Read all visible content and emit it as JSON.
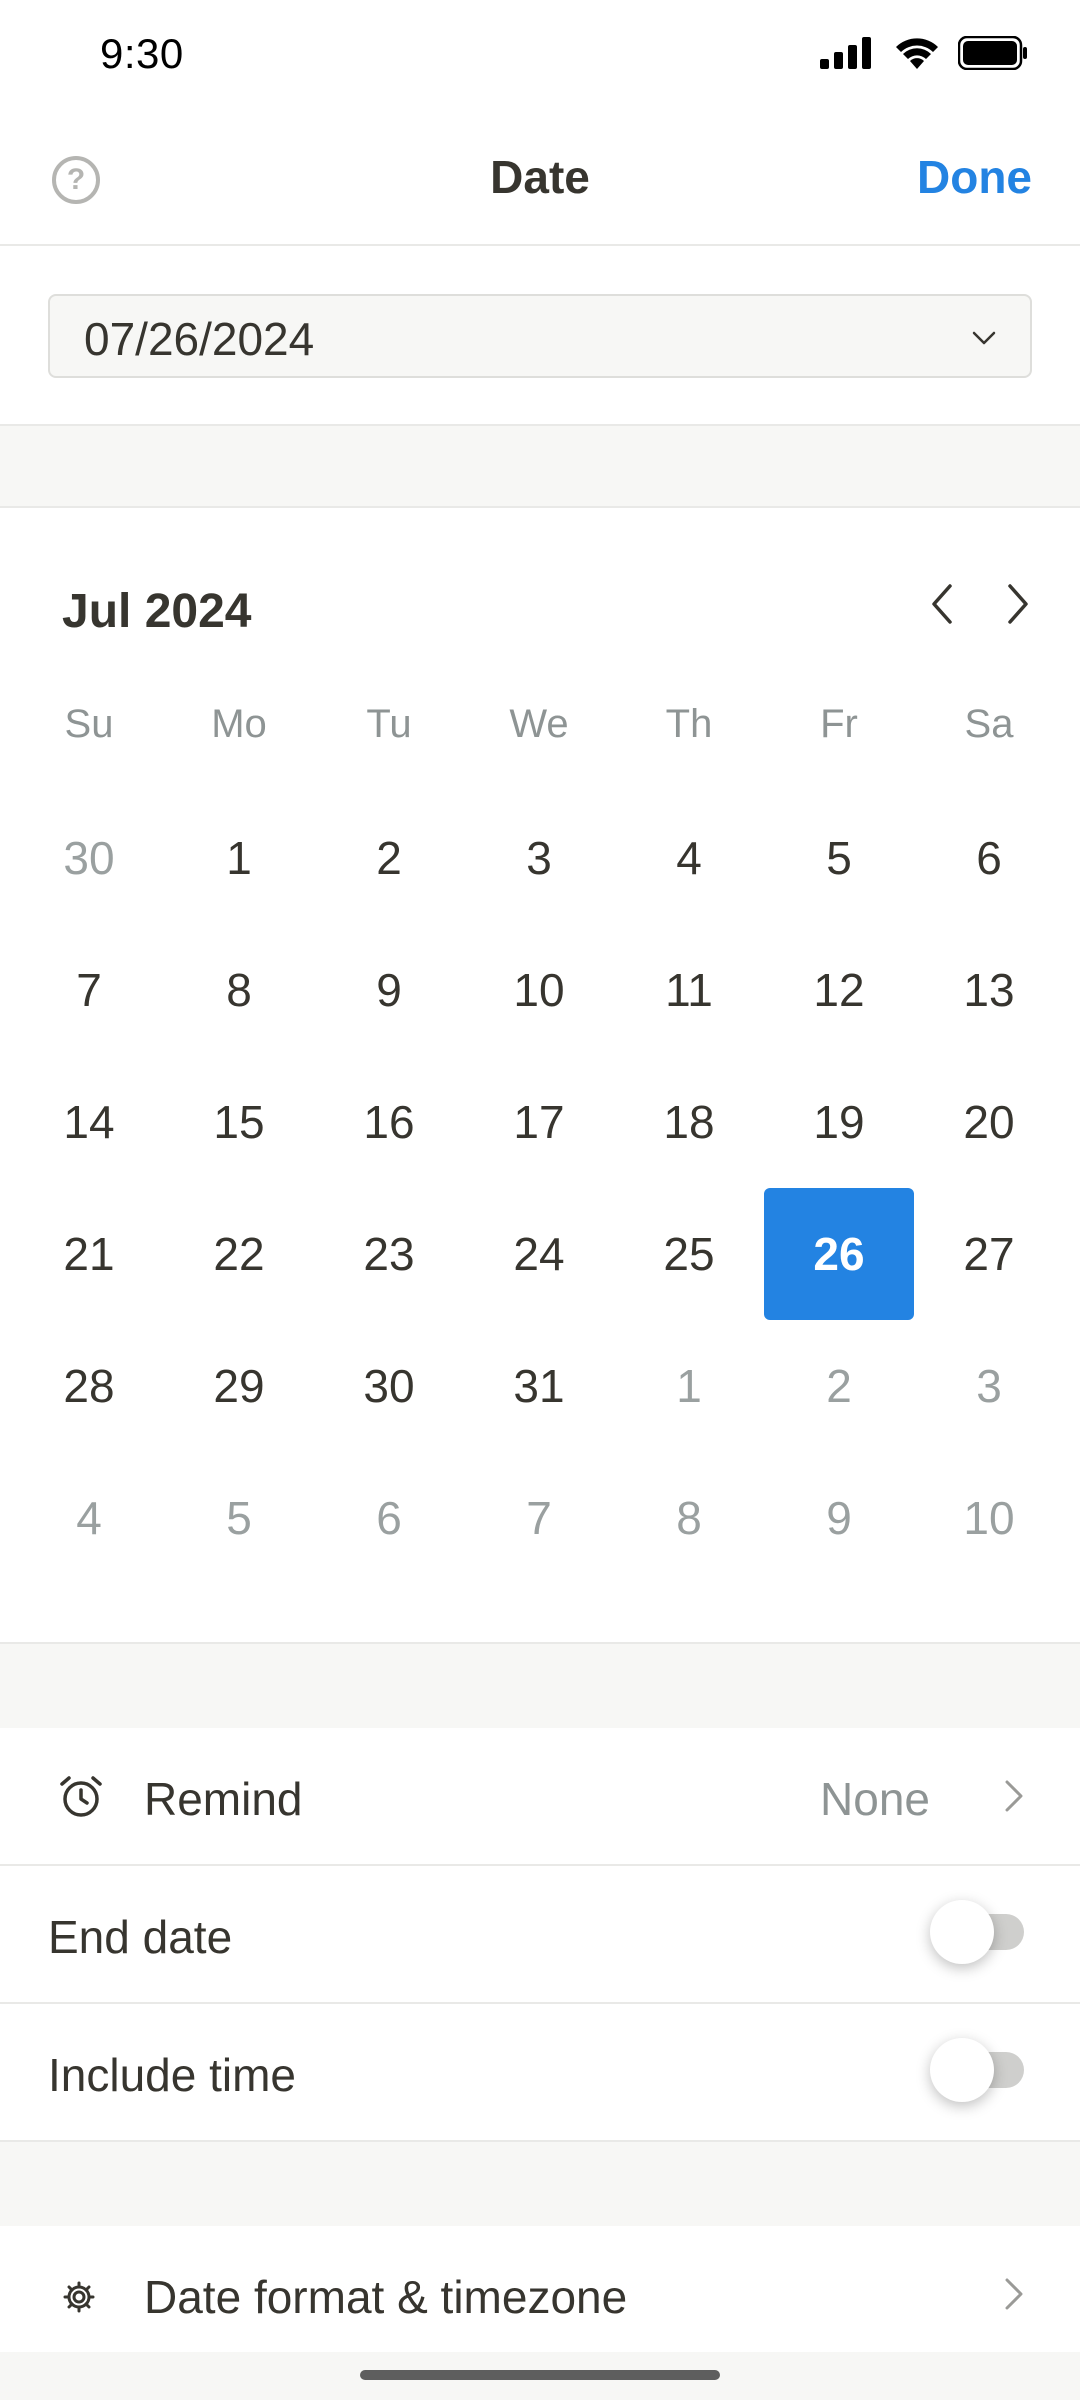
{
  "status_bar": {
    "time": "9:30",
    "icons": [
      "signal-icon",
      "wifi-icon",
      "battery-icon"
    ]
  },
  "header": {
    "title": "Date",
    "done_label": "Done",
    "help_symbol": "?"
  },
  "date_input": {
    "value": "07/26/2024"
  },
  "calendar": {
    "month_label": "Jul 2024",
    "weekdays": [
      "Su",
      "Mo",
      "Tu",
      "We",
      "Th",
      "Fr",
      "Sa"
    ],
    "selected_day": "26",
    "weeks": [
      [
        {
          "d": "30",
          "other": true
        },
        {
          "d": "1"
        },
        {
          "d": "2"
        },
        {
          "d": "3"
        },
        {
          "d": "4"
        },
        {
          "d": "5"
        },
        {
          "d": "6"
        }
      ],
      [
        {
          "d": "7"
        },
        {
          "d": "8"
        },
        {
          "d": "9"
        },
        {
          "d": "10"
        },
        {
          "d": "11"
        },
        {
          "d": "12"
        },
        {
          "d": "13"
        }
      ],
      [
        {
          "d": "14"
        },
        {
          "d": "15"
        },
        {
          "d": "16"
        },
        {
          "d": "17"
        },
        {
          "d": "18"
        },
        {
          "d": "19"
        },
        {
          "d": "20"
        }
      ],
      [
        {
          "d": "21"
        },
        {
          "d": "22"
        },
        {
          "d": "23"
        },
        {
          "d": "24"
        },
        {
          "d": "25"
        },
        {
          "d": "26",
          "selected": true
        },
        {
          "d": "27"
        }
      ],
      [
        {
          "d": "28"
        },
        {
          "d": "29"
        },
        {
          "d": "30"
        },
        {
          "d": "31"
        },
        {
          "d": "1",
          "other": true
        },
        {
          "d": "2",
          "other": true
        },
        {
          "d": "3",
          "other": true
        }
      ],
      [
        {
          "d": "4",
          "other": true
        },
        {
          "d": "5",
          "other": true
        },
        {
          "d": "6",
          "other": true
        },
        {
          "d": "7",
          "other": true
        },
        {
          "d": "8",
          "other": true
        },
        {
          "d": "9",
          "other": true
        },
        {
          "d": "10",
          "other": true
        }
      ]
    ]
  },
  "options": {
    "remind_label": "Remind",
    "remind_value": "None",
    "end_date_label": "End date",
    "end_date_on": false,
    "include_time_label": "Include time",
    "include_time_on": false,
    "format_label": "Date format & timezone"
  },
  "colors": {
    "accent": "#2383e2",
    "text": "#37352f",
    "muted": "#8e9494",
    "separator_bg": "#f7f7f5"
  }
}
